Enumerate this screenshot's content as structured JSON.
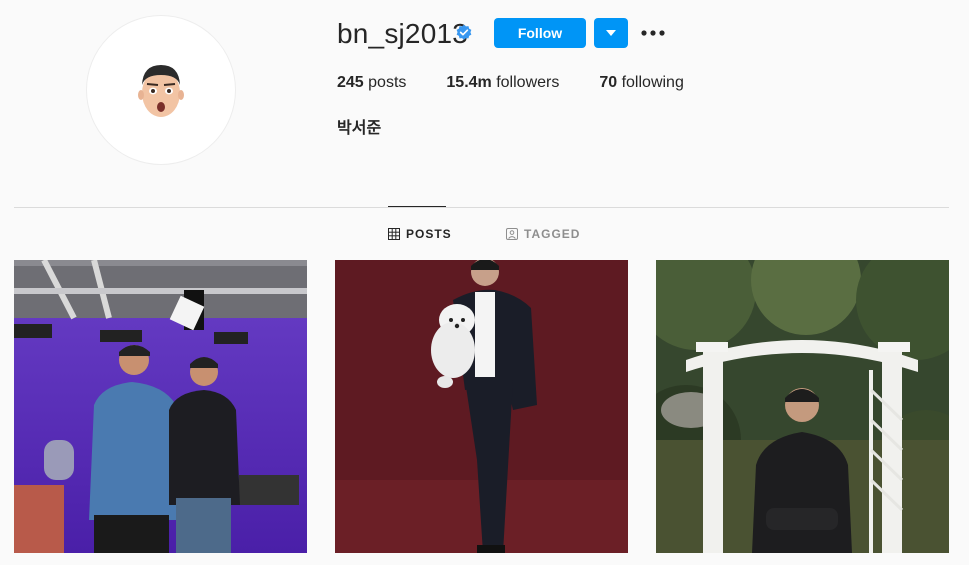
{
  "profile": {
    "username": "bn_sj2013",
    "verified": true,
    "full_name": "박서준",
    "follow_label": "Follow",
    "stats": {
      "posts_count": "245",
      "posts_label": " posts",
      "followers_count": "15.4m",
      "followers_label": " followers",
      "following_count": "70",
      "following_label": " following"
    }
  },
  "tabs": [
    {
      "label": "POSTS",
      "icon": "grid-icon",
      "active": true
    },
    {
      "label": "TAGGED",
      "icon": "tag-icon",
      "active": false
    }
  ],
  "colors": {
    "accent": "#0095f6",
    "background": "#fafafa",
    "text": "#262626",
    "muted": "#8e8e8e"
  },
  "posts": [
    {
      "description": "two-men-in-purple-studio"
    },
    {
      "description": "man-holding-white-dog"
    },
    {
      "description": "man-at-white-garden-arch"
    }
  ]
}
